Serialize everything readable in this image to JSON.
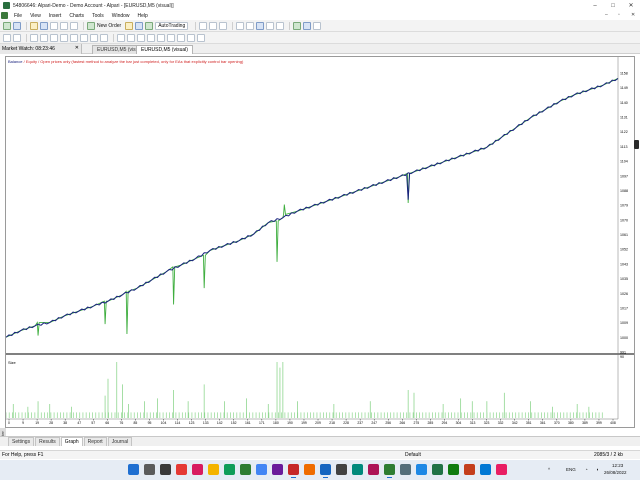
{
  "window": {
    "title": "54806646: Alpari-Demo - Demo Account - Alpari - [EURUSD,M5 (visual)]",
    "controls": [
      "–",
      "□",
      "✕"
    ]
  },
  "menu": {
    "items": [
      "File",
      "View",
      "Insert",
      "Charts",
      "Tools",
      "Window",
      "Help"
    ],
    "mdi_controls": [
      "–",
      "▫",
      "✕"
    ]
  },
  "toolbar": {
    "new_order_label": "New Order",
    "autotrading_label": "AutoTrading"
  },
  "market_watch": {
    "label": "Market Watch: 08:23:46",
    "close": "✕"
  },
  "chart_tabs": [
    {
      "label": "EURUSD,M5 (visual)",
      "active": false
    },
    {
      "label": "EURUSD,M5 (visual)",
      "active": true
    }
  ],
  "chart_info": {
    "balance_word": "Balance",
    "equity_word": "Equity",
    "message": "/ Open prices only (fastest method to analyze the bar just completed, only for EAs that explicitly control bar opening)",
    "size_label": "Size"
  },
  "chart_data": {
    "type": "line",
    "colors": {
      "balance": "#1a237e",
      "equity": "#3fae3f",
      "size": "#8fd68f"
    },
    "y_ticks": [
      "1158",
      "1149",
      "1140",
      "1131",
      "1122",
      "1113",
      "1104",
      "1097",
      "1088",
      "1079",
      "1070",
      "1061",
      "1052",
      "1043",
      "1035",
      "1026",
      "1017",
      "1009",
      "1000",
      "991"
    ],
    "x_ticks": [
      "0",
      "9",
      "19",
      "28",
      "38",
      "47",
      "57",
      "66",
      "76",
      "85",
      "95",
      "104",
      "114",
      "123",
      "133",
      "142",
      "152",
      "161",
      "171",
      "180",
      "190",
      "199",
      "209",
      "218",
      "228",
      "237",
      "247",
      "256",
      "266",
      "275",
      "285",
      "294",
      "304",
      "313",
      "323",
      "332",
      "342",
      "351",
      "361",
      "370",
      "380",
      "389",
      "399",
      "408"
    ],
    "balance": [
      [
        0,
        1000
      ],
      [
        10,
        1004
      ],
      [
        20,
        1007
      ],
      [
        30,
        1009
      ],
      [
        40,
        1013
      ],
      [
        50,
        1016
      ],
      [
        60,
        1019
      ],
      [
        70,
        1022
      ],
      [
        80,
        1026
      ],
      [
        90,
        1030
      ],
      [
        100,
        1035
      ],
      [
        110,
        1040
      ],
      [
        120,
        1044
      ],
      [
        130,
        1048
      ],
      [
        140,
        1053
      ],
      [
        150,
        1056
      ],
      [
        160,
        1059
      ],
      [
        170,
        1063
      ],
      [
        180,
        1070
      ],
      [
        190,
        1073
      ],
      [
        200,
        1077
      ],
      [
        210,
        1080
      ],
      [
        220,
        1083
      ],
      [
        230,
        1086
      ],
      [
        240,
        1089
      ],
      [
        250,
        1092
      ],
      [
        260,
        1095
      ],
      [
        270,
        1098
      ],
      [
        280,
        1101
      ],
      [
        290,
        1104
      ],
      [
        300,
        1107
      ],
      [
        310,
        1110
      ],
      [
        320,
        1113
      ],
      [
        330,
        1116
      ],
      [
        340,
        1122
      ],
      [
        350,
        1128
      ],
      [
        360,
        1134
      ],
      [
        370,
        1139
      ],
      [
        380,
        1144
      ],
      [
        390,
        1148
      ],
      [
        400,
        1151
      ],
      [
        410,
        1154
      ],
      [
        420,
        1158
      ]
    ],
    "equity_dips": [
      [
        22,
        1009,
        1001
      ],
      [
        68,
        1022,
        1008
      ],
      [
        83,
        1028,
        1002
      ],
      [
        110,
        1040,
        1012
      ],
      [
        115,
        1043,
        1020
      ],
      [
        136,
        1050,
        1030
      ],
      [
        186,
        1071,
        1046
      ],
      [
        191,
        1075,
        1081
      ],
      [
        276,
        1100,
        1082
      ],
      [
        330,
        1116,
        1140
      ]
    ],
    "size_bars": {
      "baseline": 0.1,
      "spikes": [
        [
          5,
          0.25
        ],
        [
          15,
          0.2
        ],
        [
          22,
          0.3
        ],
        [
          30,
          0.25
        ],
        [
          45,
          0.2
        ],
        [
          68,
          0.4
        ],
        [
          70,
          0.7
        ],
        [
          76,
          1.0
        ],
        [
          80,
          0.6
        ],
        [
          84,
          0.25
        ],
        [
          95,
          0.3
        ],
        [
          104,
          0.35
        ],
        [
          115,
          0.5
        ],
        [
          125,
          0.3
        ],
        [
          136,
          0.6
        ],
        [
          150,
          0.3
        ],
        [
          165,
          0.35
        ],
        [
          180,
          0.25
        ],
        [
          186,
          1.0
        ],
        [
          188,
          0.9
        ],
        [
          190,
          1.0
        ],
        [
          200,
          0.3
        ],
        [
          225,
          0.25
        ],
        [
          250,
          0.3
        ],
        [
          276,
          0.5
        ],
        [
          280,
          0.45
        ],
        [
          300,
          0.25
        ],
        [
          312,
          0.35
        ],
        [
          320,
          0.3
        ],
        [
          330,
          0.3
        ],
        [
          342,
          0.45
        ],
        [
          360,
          0.3
        ],
        [
          375,
          0.2
        ],
        [
          392,
          0.25
        ],
        [
          400,
          0.2
        ]
      ]
    },
    "size_y_label": "90"
  },
  "bottom_tabs": [
    "Settings",
    "Results",
    "Graph",
    "Report",
    "Journal"
  ],
  "bottom_active": "Graph",
  "side_label": "Tester",
  "status": {
    "help": "For Help, press F1",
    "profile": "Default",
    "connection": "2085/3 / 2 kb"
  },
  "tray": {
    "lang": "ENG",
    "time": "12:23",
    "date": "26/08/2022"
  }
}
